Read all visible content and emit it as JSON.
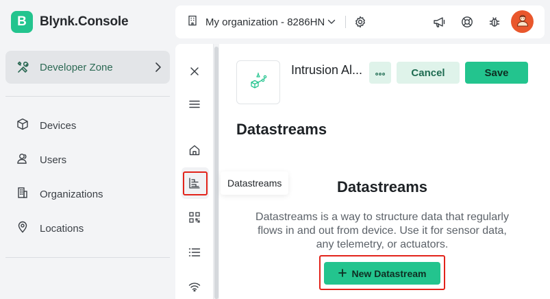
{
  "app": {
    "brand_letter": "B",
    "brand_name": "Blynk.Console",
    "accent_color": "#23c48e"
  },
  "sidebar": {
    "developer_zone": {
      "label": "Developer Zone",
      "icon": "tools-icon"
    },
    "items": [
      {
        "label": "Devices",
        "icon": "cube-icon"
      },
      {
        "label": "Users",
        "icon": "users-icon"
      },
      {
        "label": "Organizations",
        "icon": "building-icon"
      },
      {
        "label": "Locations",
        "icon": "location-pin-icon"
      }
    ]
  },
  "header": {
    "org_name": "My organization - 8286HN",
    "icons": [
      "building-icon",
      "chevron-down-icon",
      "gear-icon",
      "megaphone-icon",
      "lifebuoy-icon",
      "bug-icon",
      "avatar-icon"
    ]
  },
  "rail": {
    "icons": [
      "close-icon",
      "menu-icon",
      "home-icon",
      "datastreams-icon",
      "qr-code-icon",
      "list-icon",
      "wifi-icon"
    ],
    "tooltip": "Datastreams"
  },
  "template": {
    "name": "Intrusion Al...",
    "icon": "template-icon",
    "more_icon": "more-dots-icon",
    "cancel_label": "Cancel",
    "save_label": "Save"
  },
  "main": {
    "section_title": "Datastreams",
    "empty_title": "Datastreams",
    "empty_description": "Datastreams is a way to structure data that regularly flows in and out from device. Use it for sensor data, any telemetry, or actuators.",
    "new_button_label": "New Datastream",
    "new_button_icon": "plus-icon"
  }
}
